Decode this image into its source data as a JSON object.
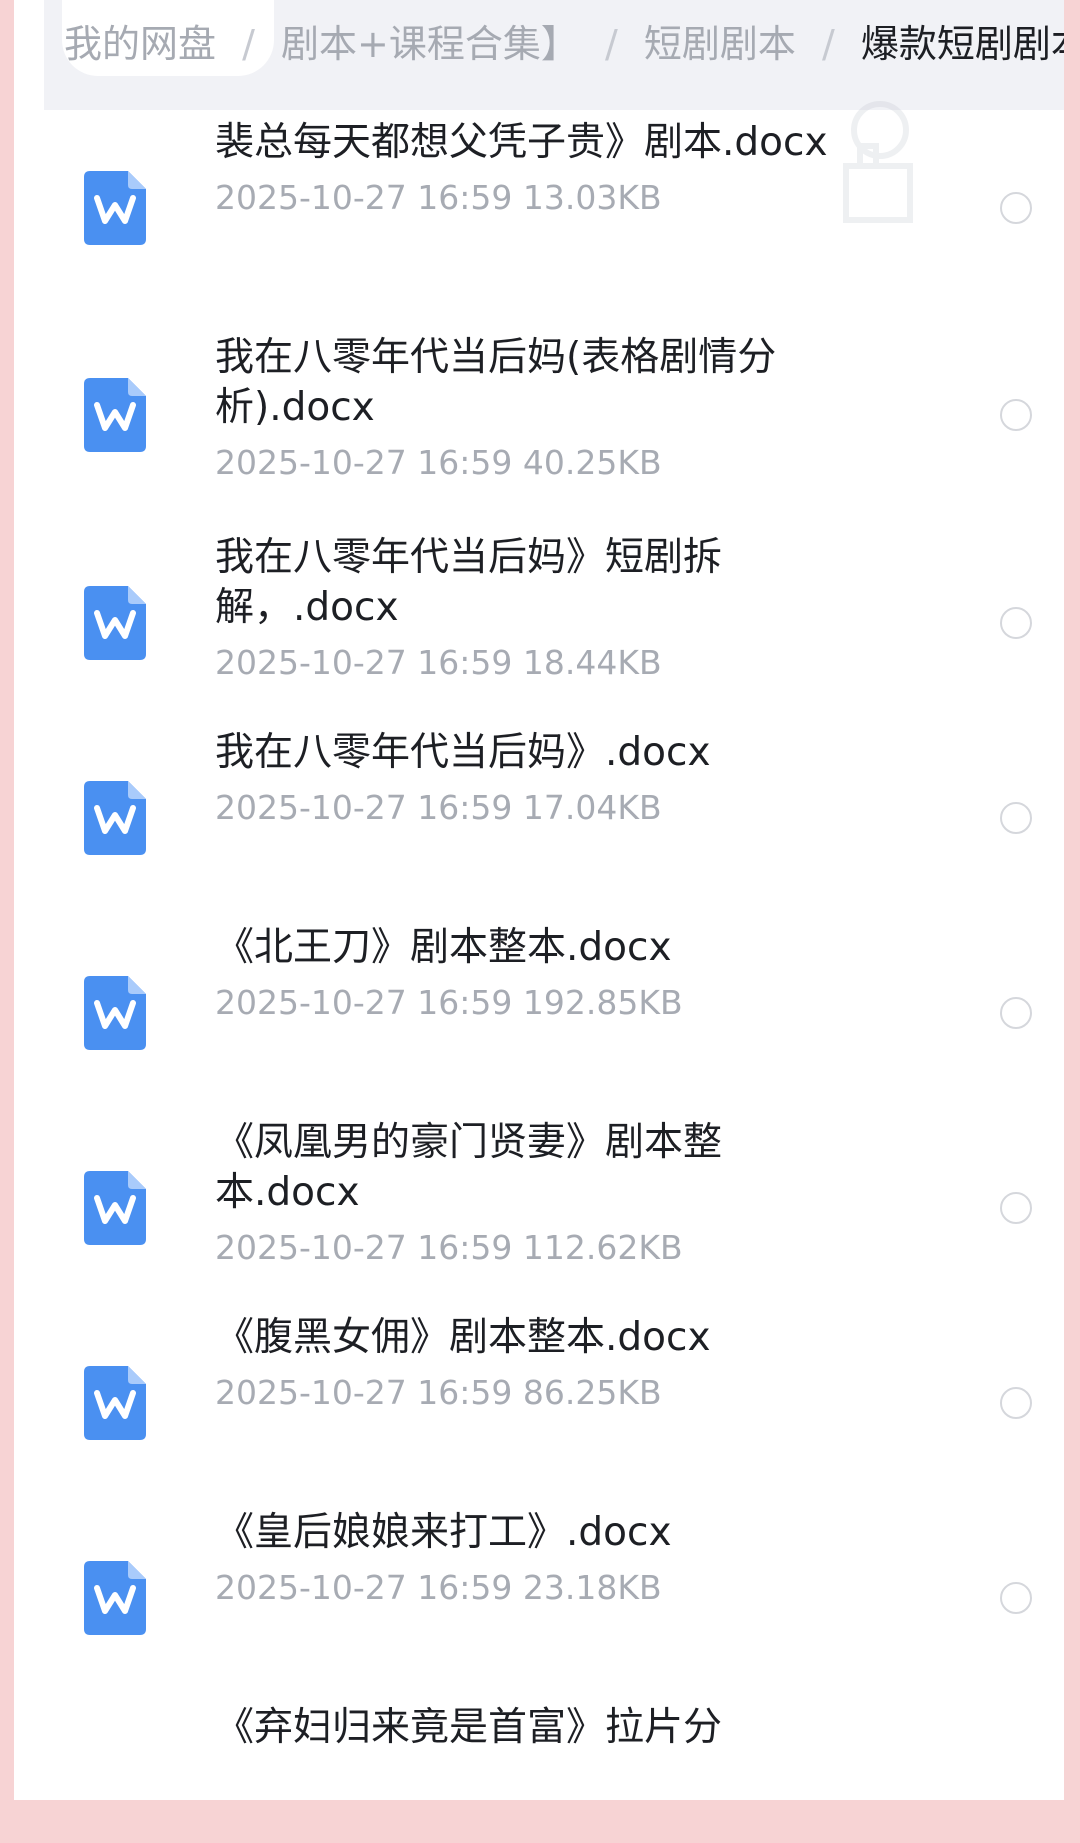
{
  "breadcrumb": {
    "items": [
      "我的网盘",
      "剧本+课程合集】",
      "短剧剧本",
      "爆款短剧剧本"
    ],
    "separator": "/"
  },
  "files": [
    {
      "name": "裴总每天都想父凭子贵》剧本.docx",
      "date": "2025-10-27",
      "time": "16:59",
      "size": "13.03KB",
      "icon": "word-doc-icon"
    },
    {
      "name": "我在八零年代当后妈(表格剧情分析).docx",
      "date": "2025-10-27",
      "time": "16:59",
      "size": "40.25KB",
      "icon": "word-doc-icon"
    },
    {
      "name": "我在八零年代当后妈》短剧拆解，.docx",
      "date": "2025-10-27",
      "time": "16:59",
      "size": "18.44KB",
      "icon": "word-doc-icon"
    },
    {
      "name": "我在八零年代当后妈》.docx",
      "date": "2025-10-27",
      "time": "16:59",
      "size": "17.04KB",
      "icon": "word-doc-icon"
    },
    {
      "name": "《北王刀》剧本整本.docx",
      "date": "2025-10-27",
      "time": "16:59",
      "size": "192.85KB",
      "icon": "word-doc-icon"
    },
    {
      "name": "《凤凰男的豪门贤妻》剧本整本.docx",
      "date": "2025-10-27",
      "time": "16:59",
      "size": "112.62KB",
      "icon": "word-doc-icon"
    },
    {
      "name": "《腹黑女佣》剧本整本.docx",
      "date": "2025-10-27",
      "time": "16:59",
      "size": "86.25KB",
      "icon": "word-doc-icon"
    },
    {
      "name": "《皇后娘娘来打工》.docx",
      "date": "2025-10-27",
      "time": "16:59",
      "size": "23.18KB",
      "icon": "word-doc-icon"
    },
    {
      "name": "《弃妇归来竟是首富》拉片分析.docx",
      "date": "",
      "time": "",
      "size": "",
      "icon": "word-doc-icon"
    }
  ],
  "colors": {
    "background": "#f7d3d4",
    "panel": "#ffffff",
    "header": "#f1f2f6",
    "icon": "#4a90f1",
    "title": "#1d1f24",
    "meta": "#a7abb3",
    "radio_border": "#d5d7dc"
  }
}
